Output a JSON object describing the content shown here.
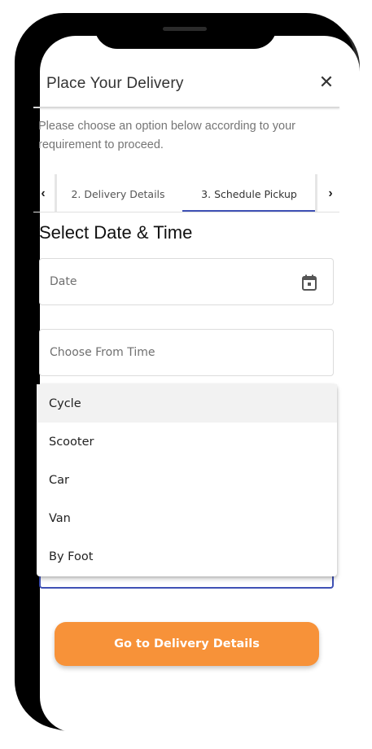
{
  "header": {
    "title": "Place Your Delivery",
    "close_symbol": "✕"
  },
  "instruction": "Please choose an option below according to your requirement to proceed.",
  "tabs": {
    "prev_symbol": "‹",
    "next_symbol": "›",
    "items": [
      {
        "label": "2. Delivery Details",
        "active": false
      },
      {
        "label": "3. Schedule Pickup",
        "active": true
      }
    ]
  },
  "section": {
    "title": "Select Date & Time"
  },
  "fields": {
    "date_label": "Date",
    "time_label": "Choose From Time"
  },
  "dropdown": {
    "highlighted_index": 0,
    "options": [
      "Cycle",
      "Scooter",
      "Car",
      "Van",
      "By Foot"
    ]
  },
  "cta": {
    "label": "Go to Delivery Details"
  },
  "colors": {
    "accent": "#3f51b5",
    "cta": "#f79239"
  },
  "icons": {
    "close": "close-icon",
    "calendar": "calendar-icon",
    "prev": "chevron-left-icon",
    "next": "chevron-right-icon"
  }
}
